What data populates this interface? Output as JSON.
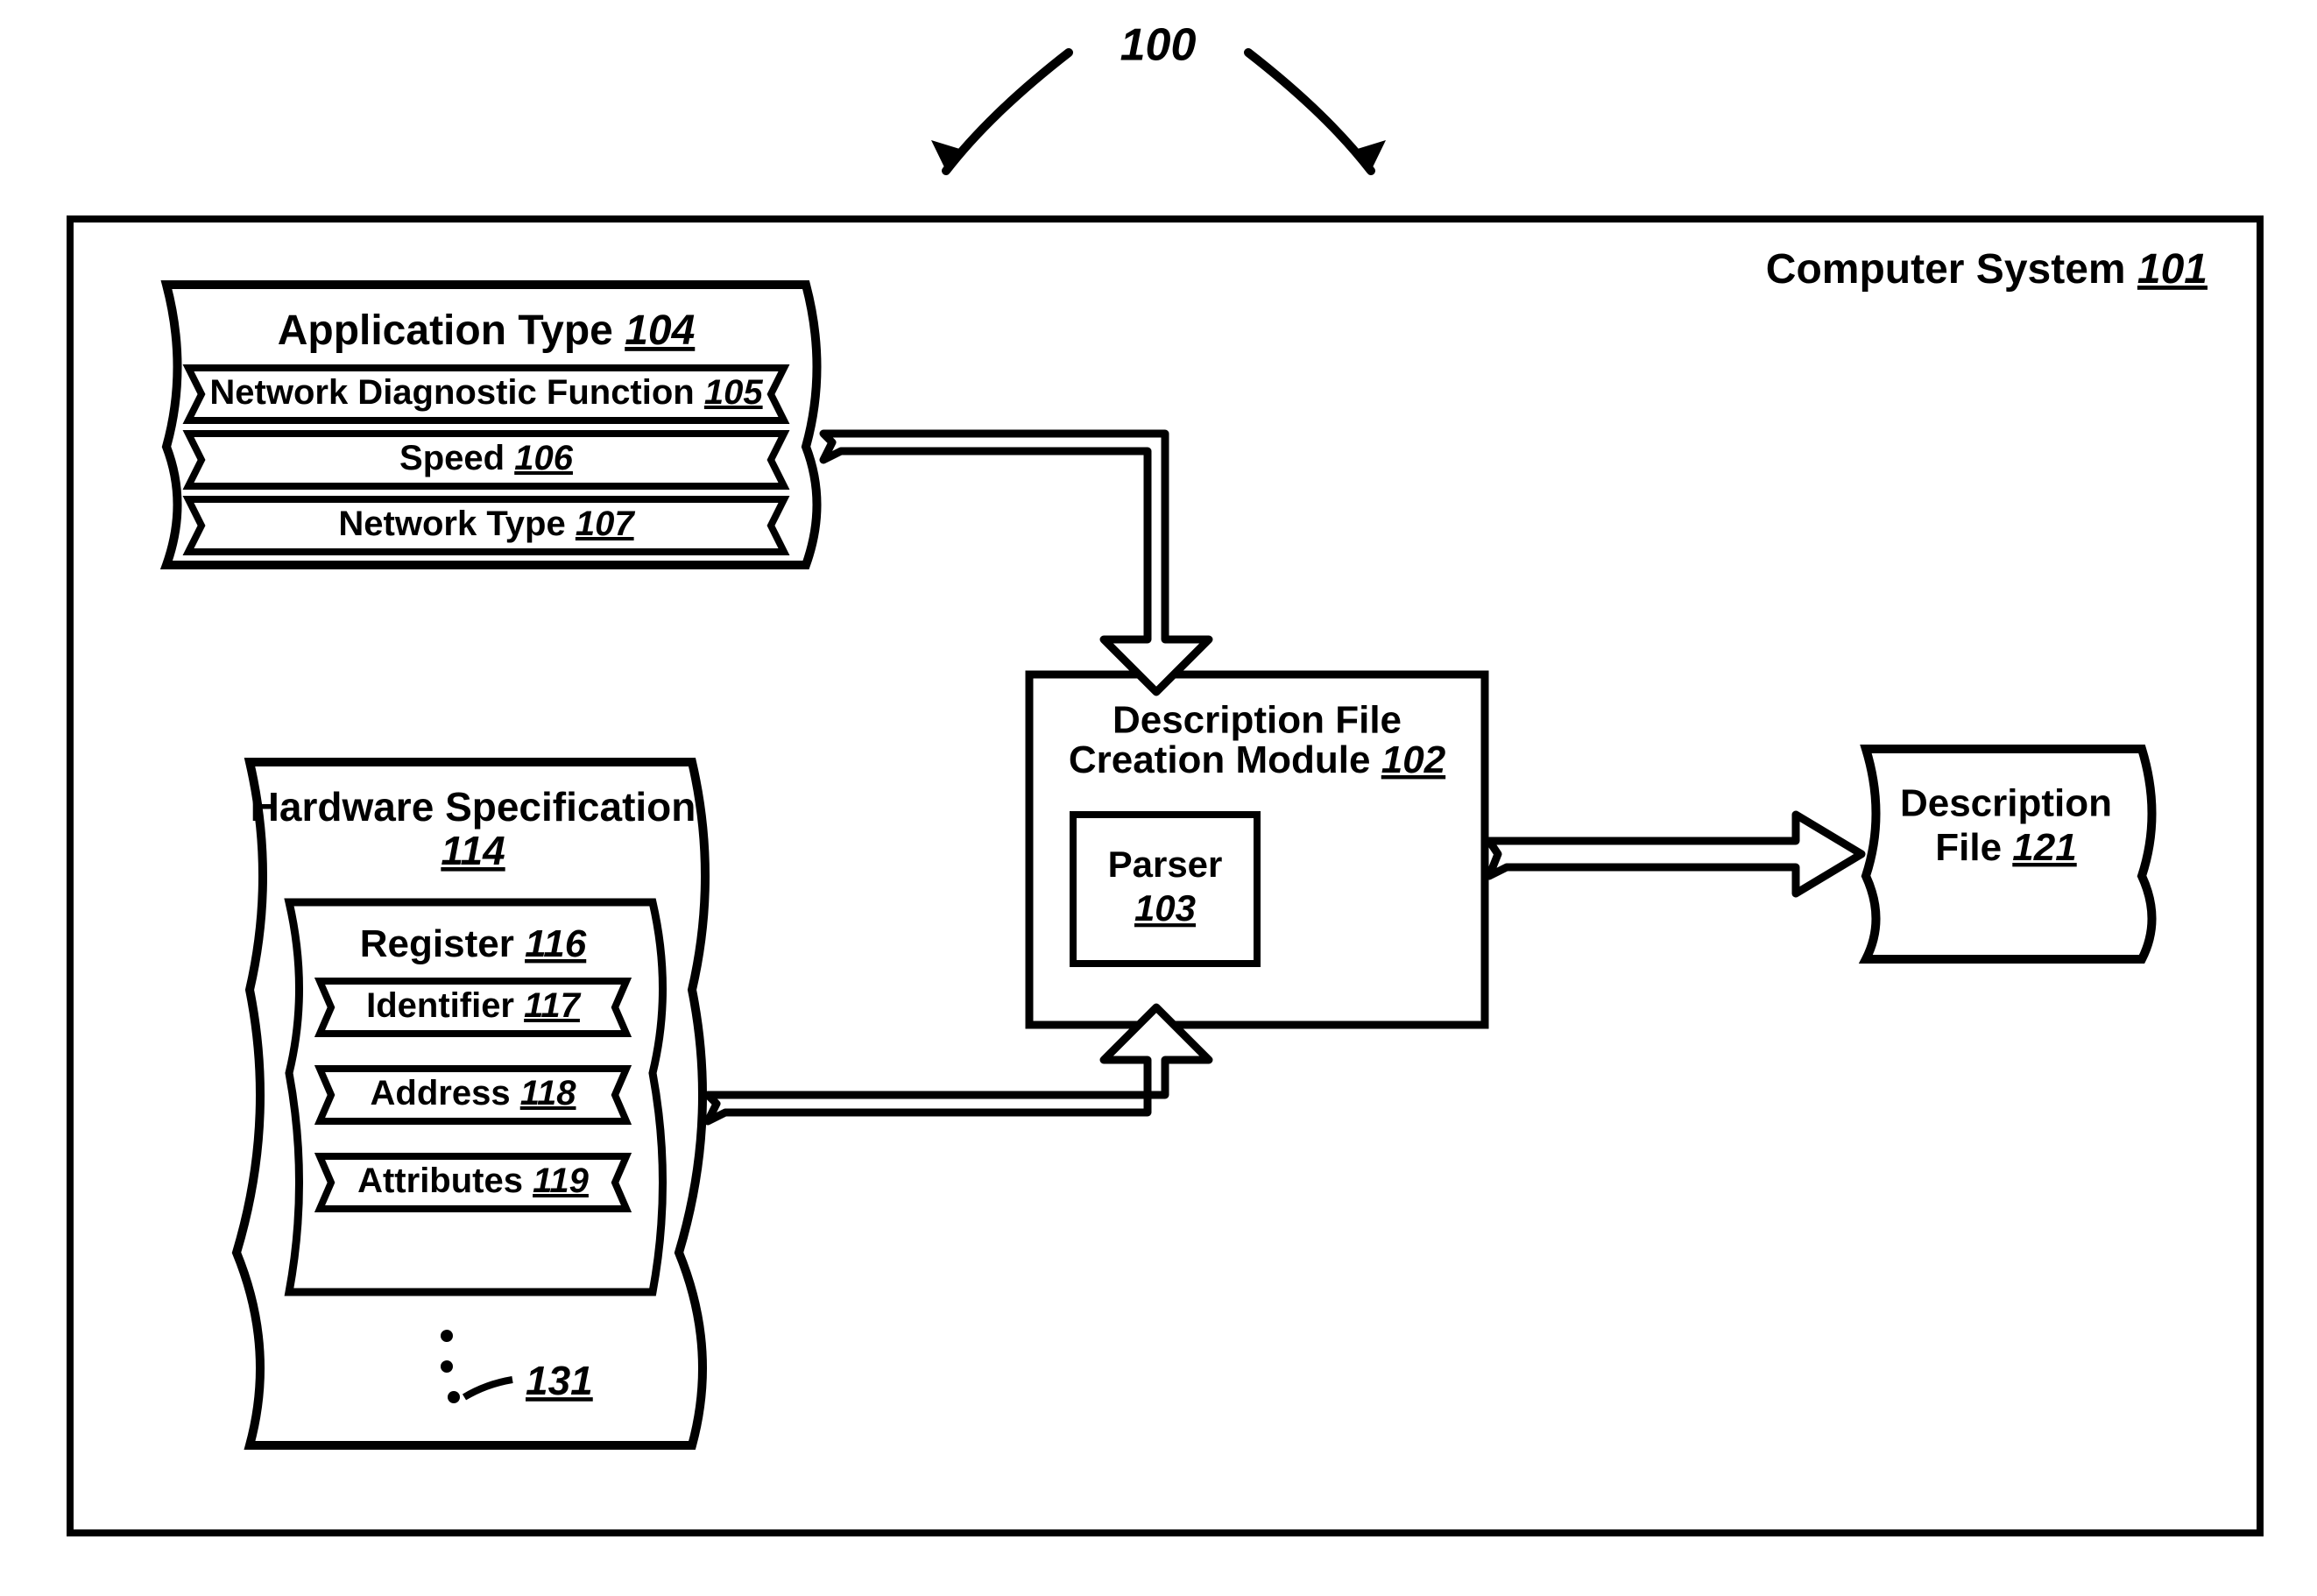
{
  "figure": {
    "label": "100",
    "container": {
      "label": "Computer System",
      "num": "101"
    },
    "app_type": {
      "title": "Application Type",
      "title_num": "104",
      "items": [
        {
          "label": "Network Diagnostic Function",
          "num": "105"
        },
        {
          "label": "Speed",
          "num": "106"
        },
        {
          "label": "Network Type",
          "num": "107"
        }
      ]
    },
    "hw_spec": {
      "title": "Hardware Specification",
      "title_num": "114",
      "register": {
        "title": "Register",
        "title_num": "116",
        "items": [
          {
            "label": "Identifier",
            "num": "117"
          },
          {
            "label": "Address",
            "num": "118"
          },
          {
            "label": "Attributes",
            "num": "119"
          }
        ],
        "more_num": "131"
      }
    },
    "module": {
      "title_l1": "Description File",
      "title_l2": "Creation Module",
      "title_num": "102",
      "parser_label": "Parser",
      "parser_num": "103"
    },
    "output": {
      "label_l1": "Description",
      "label_l2": "File",
      "num": "121"
    }
  }
}
